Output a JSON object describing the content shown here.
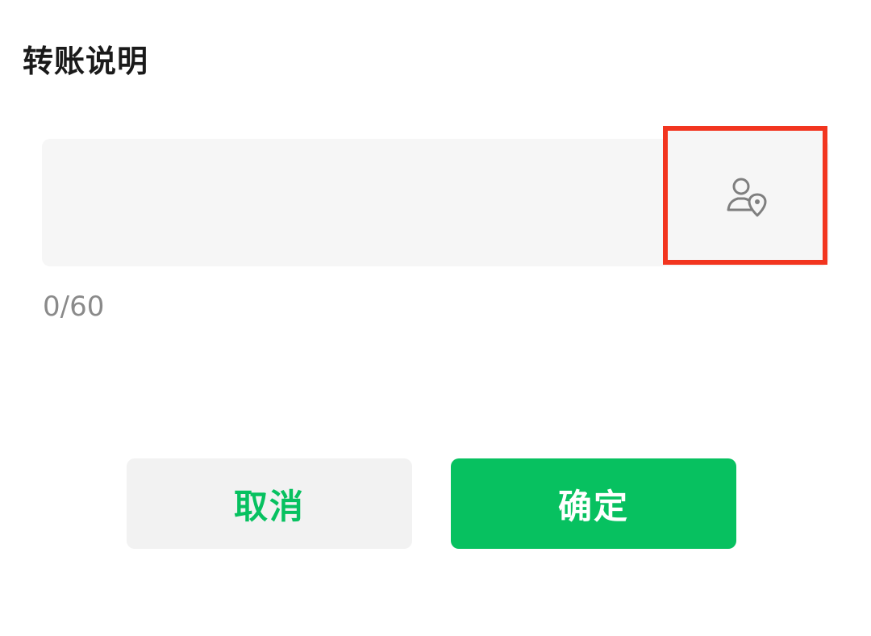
{
  "dialog": {
    "title": "转账说明",
    "input": {
      "value": "",
      "placeholder": ""
    },
    "counter": "0/60",
    "remark_icon": "person-location-icon",
    "cancel_label": "取消",
    "confirm_label": "确定"
  },
  "colors": {
    "accent_green": "#07c160",
    "highlight_red": "#f2351f",
    "input_bg": "#f6f6f6",
    "cancel_bg": "#f2f2f2",
    "counter_text": "#8a8a8a"
  }
}
